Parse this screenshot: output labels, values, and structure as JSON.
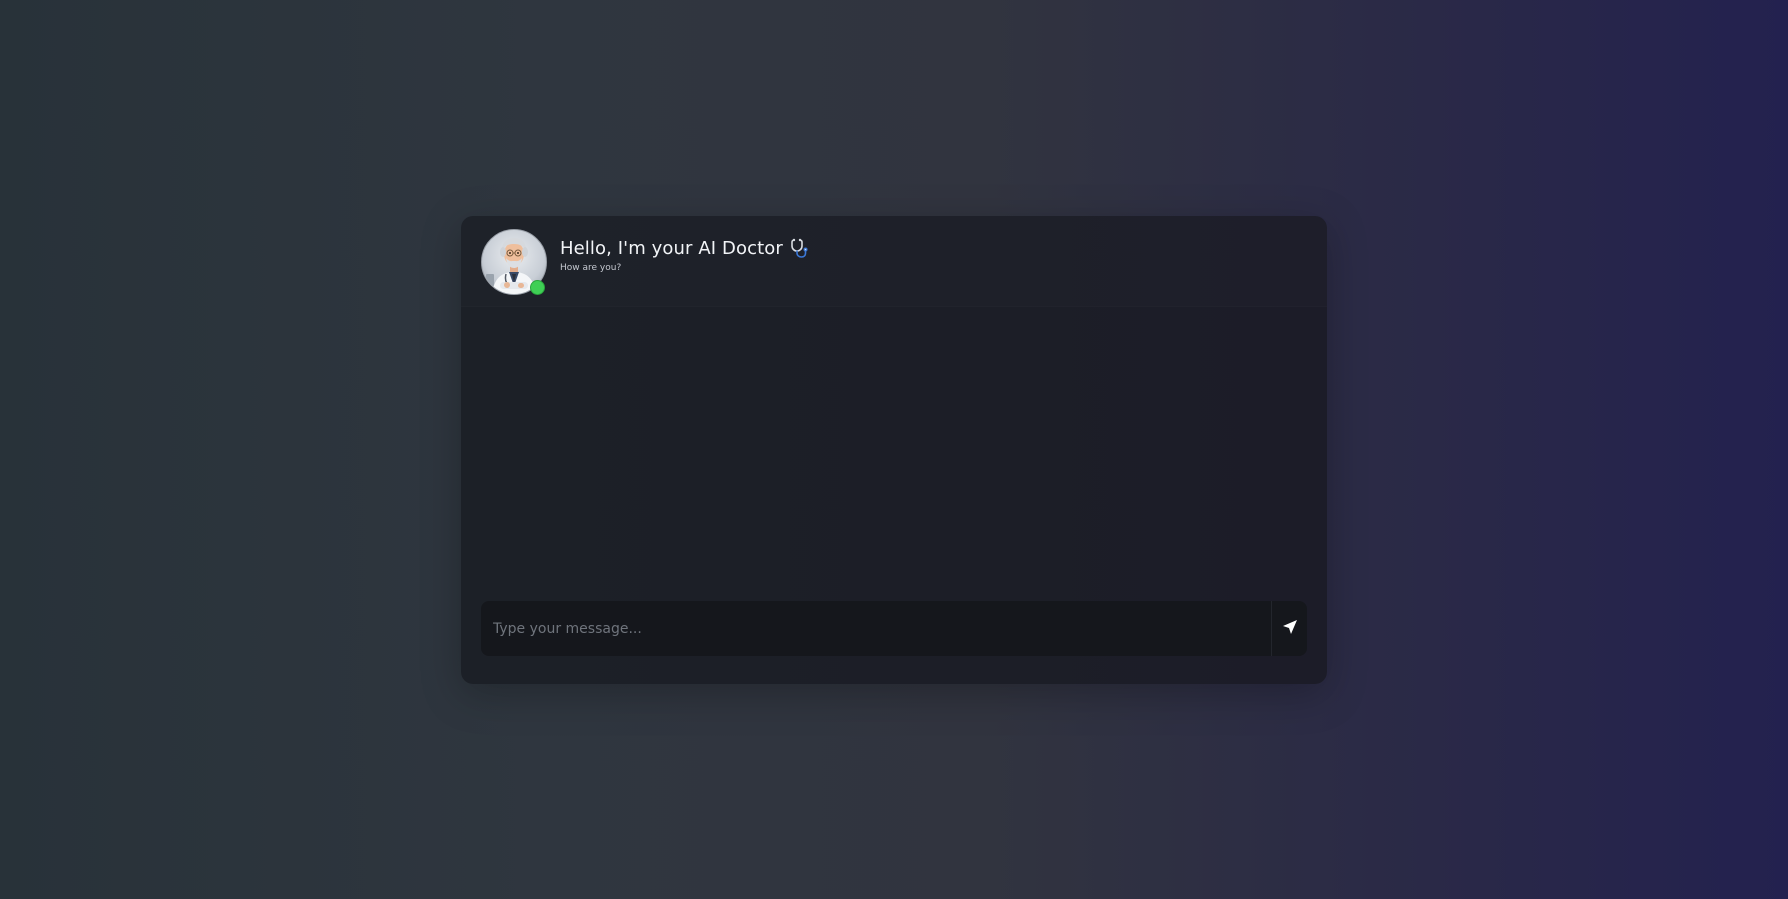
{
  "header": {
    "title": "Hello, I'm your AI Doctor",
    "title_icon": "stethoscope-icon",
    "subtitle": "How are you?",
    "avatar": "doctor-avatar",
    "status": "online",
    "status_color": "#3fcf55"
  },
  "composer": {
    "placeholder": "Type your message...",
    "value": "",
    "send_icon": "send-icon"
  },
  "colors": {
    "card_background": "#1c1e27",
    "input_background": "#15171c",
    "text_primary": "#f2f4f7",
    "text_secondary": "#c4c8cf"
  },
  "messages": []
}
